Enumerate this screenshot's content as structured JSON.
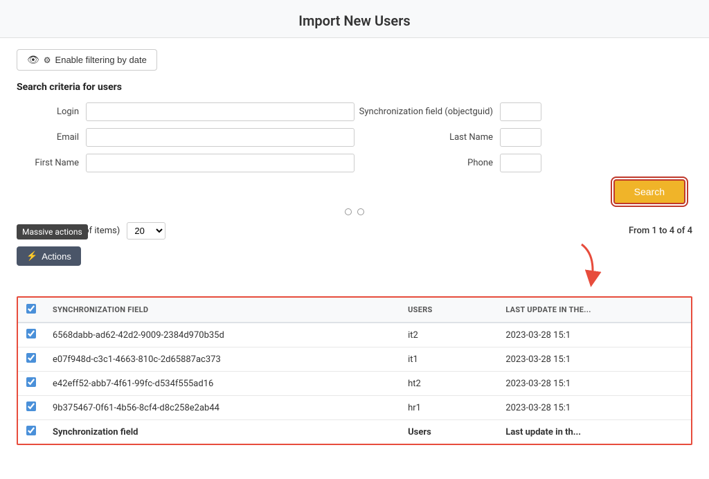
{
  "header": {
    "title": "Import New Users"
  },
  "filterBtn": {
    "label": "Enable filtering by date"
  },
  "searchSection": {
    "title": "Search criteria for users",
    "fields": {
      "login_label": "Login",
      "email_label": "Email",
      "first_name_label": "First Name",
      "sync_field_label": "Synchronization field (objectguid)",
      "last_name_label": "Last Name",
      "phone_label": "Phone"
    },
    "search_button": "Search"
  },
  "toolbar": {
    "display_label": "Display (number of items)",
    "items_per_page": "20",
    "from_label": "From 1 to 4 of 4",
    "massive_actions_tooltip": "Massive actions",
    "actions_btn": "Actions"
  },
  "table": {
    "headers": {
      "checkbox": "",
      "sync_field": "Synchronization Field",
      "users": "Users",
      "last_update": "Last update in the..."
    },
    "rows": [
      {
        "checked": true,
        "sync_field": "6568dabb-ad62-42d2-9009-2384d970b35d",
        "users": "it2",
        "last_update": "2023-03-28 15:1"
      },
      {
        "checked": true,
        "sync_field": "e07f948d-c3c1-4663-810c-2d65887ac373",
        "users": "it1",
        "last_update": "2023-03-28 15:1"
      },
      {
        "checked": true,
        "sync_field": "e42eff52-abb7-4f61-99fc-d534f555ad16",
        "users": "ht2",
        "last_update": "2023-03-28 15:1"
      },
      {
        "checked": true,
        "sync_field": "9b375467-0f61-4b56-8cf4-d8c258e2ab44",
        "users": "hr1",
        "last_update": "2023-03-28 15:1"
      }
    ],
    "footer": {
      "sync_field": "Synchronization field",
      "users": "Users",
      "last_update": "Last update in th..."
    }
  }
}
